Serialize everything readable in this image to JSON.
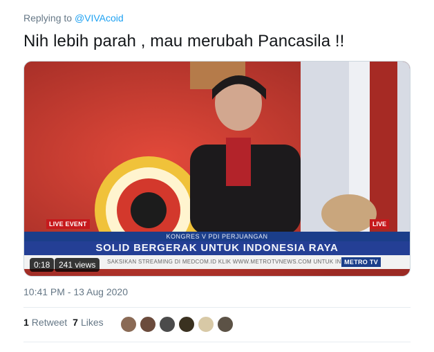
{
  "reply": {
    "prefix": "Replying to",
    "handle": "@VIVAcoid"
  },
  "tweet": {
    "text": "Nih lebih parah , mau merubah Pancasila !!"
  },
  "media": {
    "live_left": "LIVE EVENT",
    "live_right": "LIVE",
    "lower_third_top": "KONGRES V PDI PERJUANGAN",
    "lower_third_main": "SOLID BERGERAK UNTUK INDONESIA RAYA",
    "ticker": "SAKSIKAN STREAMING DI MEDCOM.ID KLIK WWW.METROTVNEWS.COM UNTUK INFORMASI",
    "channel_logo": "METRO TV",
    "duration": "0:18",
    "views": "241 views"
  },
  "meta": {
    "timestamp": "10:41 PM - 13 Aug 2020"
  },
  "stats": {
    "retweets_count": "1",
    "retweets_label": "Retweet",
    "likes_count": "7",
    "likes_label": "Likes"
  },
  "avatars": [
    {
      "color": "#8a6a55"
    },
    {
      "color": "#6b4b3c"
    },
    {
      "color": "#4b4b4b"
    },
    {
      "color": "#3a3120"
    },
    {
      "color": "#d8c9a6"
    },
    {
      "color": "#5c5246"
    }
  ]
}
